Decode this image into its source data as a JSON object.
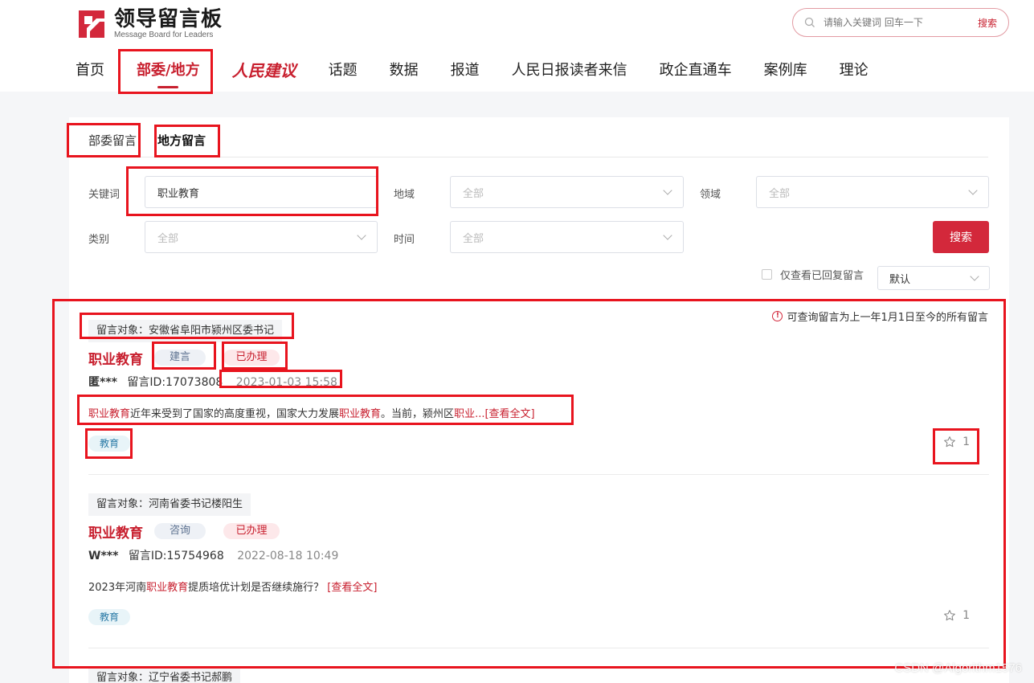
{
  "header": {
    "logo_title": "领导留言板",
    "logo_subtitle": "Message Board for Leaders",
    "search_placeholder": "请输入关键词 回车一下",
    "search_button": "搜索",
    "nav": [
      "首页",
      "部委/地方",
      "人民建议",
      "话题",
      "数据",
      "报道",
      "人民日报读者来信",
      "政企直通车",
      "案例库",
      "理论"
    ],
    "active_nav": "部委/地方"
  },
  "tabs": {
    "items": [
      "部委留言",
      "地方留言"
    ],
    "active": "地方留言"
  },
  "filters": {
    "keyword_label": "关键词",
    "keyword_value": "职业教育",
    "region_label": "地域",
    "region_value": "全部",
    "field_label": "领域",
    "field_value": "全部",
    "category_label": "类别",
    "category_value": "全部",
    "time_label": "时间",
    "time_value": "全部",
    "search_button": "搜索",
    "only_replied_label": "仅查看已回复留言",
    "sort_value": "默认"
  },
  "notice": "可查询留言为上一年1月1日至今的所有留言",
  "messages": [
    {
      "target": "留言对象：安徽省阜阳市颍州区委书记",
      "title": "职业教育",
      "type": "建言",
      "status": "已办理",
      "author": "匿***",
      "message_id": "留言ID:17073808",
      "time": "2023-01-03 15:58",
      "content_parts": [
        "职业教育",
        "近年来受到了国家的高度重视，国家大力发展",
        "职业教育",
        "。当前，颍州区",
        "职业",
        "...",
        "[查看全文]"
      ],
      "topic": "教育",
      "likes": "1"
    },
    {
      "target": "留言对象：河南省委书记楼阳生",
      "title": "职业教育",
      "type": "咨询",
      "status": "已办理",
      "author": "W***",
      "message_id": "留言ID:15754968",
      "time": "2022-08-18 10:49",
      "content_parts": [
        "2023年河南",
        "职业教育",
        "提质培优计划是否继续施行？",
        "[查看全文]"
      ],
      "topic": "教育",
      "likes": "1"
    },
    {
      "target": "留言对象：辽宁省委书记郝鹏"
    }
  ],
  "watermark": "CSDN @Algorithm1576",
  "colors": {
    "brand_red": "#c8202f",
    "search_button": "#d3283b",
    "annotation": "#e8141e"
  }
}
